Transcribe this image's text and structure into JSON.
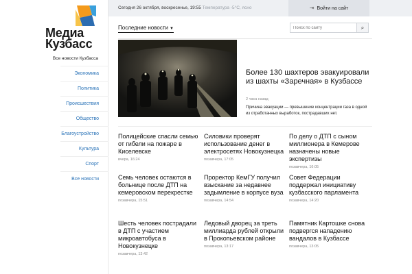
{
  "brand": {
    "name_line1": "Медиа",
    "name_line2": "Кузбасс",
    "tagline": "Все новости Кузбасса"
  },
  "nav": [
    "Экономика",
    "Политика",
    "Происшествия",
    "Общество",
    "Благоустройство",
    "Культура",
    "Спорт",
    "Все новости"
  ],
  "topbar": {
    "date_text": "Сегодня 26 октября, воскресенье, 19:55",
    "temperature_text": "Температура -5°С, ясно",
    "login_label": "Войти на сайт"
  },
  "main": {
    "latest_label": "Последние новости",
    "search_placeholder": "Поиск по сайту"
  },
  "featured": {
    "title": "Более 130 шахтеров эвакуировали из шахты «Заречная» в Кузбассе",
    "time": "2 часа назад",
    "text": "Причина эвакуации — превышение концентрации газа в одной из отработанных выработок, пострадавших нет."
  },
  "news": [
    {
      "title": "Полицейские спасли семью от гибели на пожаре в Киселевске",
      "time": "вчера, 16:24"
    },
    {
      "title": "Силовики проверят использование денег в электросетях Новокузнецка",
      "time": "позавчера, 17:05"
    },
    {
      "title": "По делу о ДТП с сыном миллионера в Кемерове назначены новые экспертизы",
      "time": "позавчера, 16:05"
    },
    {
      "title": "Семь человек остаются в больнице после ДТП на кемеровском перекрестке",
      "time": "позавчера, 15:51"
    },
    {
      "title": "Проректор КемГУ получил взыскание за недавнее задымление в корпусе вуза",
      "time": "позавчера, 14:54"
    },
    {
      "title": "Совет Федерации поддержал инициативу кузбасского парламента",
      "time": "позавчера, 14:20"
    },
    {
      "title": "Шесть человек пострадали в ДТП с участием микроавтобуса в Новокузнецке",
      "time": "позавчера, 13:42"
    },
    {
      "title": "Ледовый дворец за треть миллиарда рублей открыли в Прокопьевском районе",
      "time": "позавчера, 13:17"
    },
    {
      "title": "Памятник Картошке снова подвергся нападению вандалов в Кузбассе",
      "time": "позавчера, 13:05"
    }
  ],
  "colors": {
    "link": "#2a73b8",
    "topbar_bg": "#eef0f3",
    "logo_orange": "#f39a1c",
    "logo_blue": "#3aa0dc"
  }
}
